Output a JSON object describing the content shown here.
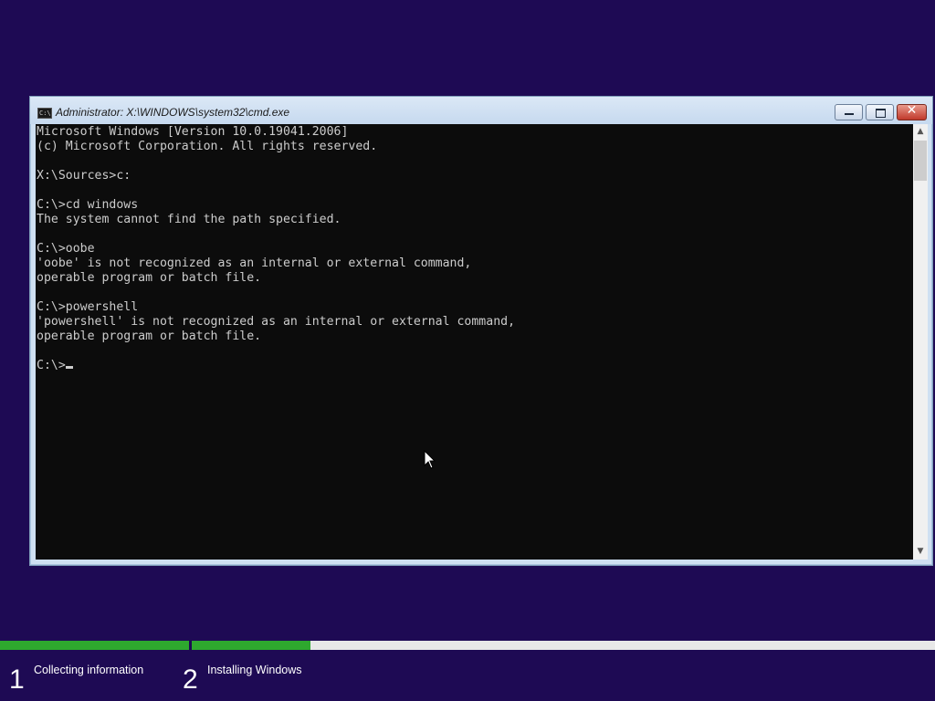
{
  "window": {
    "title": "Administrator: X:\\WINDOWS\\system32\\cmd.exe",
    "icon_name": "cmd-icon",
    "icon_text": "C:\\",
    "controls": [
      "minimize",
      "maximize",
      "close"
    ],
    "close_glyph": "✕"
  },
  "console": {
    "text": "Microsoft Windows [Version 10.0.19041.2006]\n(c) Microsoft Corporation. All rights reserved.\n\nX:\\Sources>c:\n\nC:\\>cd windows\nThe system cannot find the path specified.\n\nC:\\>oobe\n'oobe' is not recognized as an internal or external command,\noperable program or batch file.\n\nC:\\>powershell\n'powershell' is not recognized as an internal or external command,\noperable program or batch file.\n\n",
    "prompt": "C:\\>",
    "background": "#0c0c0c",
    "foreground": "#cccccc"
  },
  "scrollbar": {
    "up_arrow": "▲",
    "down_arrow": "▼"
  },
  "setup_progress": {
    "steps": [
      {
        "number": "1",
        "label": "Collecting information",
        "complete": 1.0
      },
      {
        "number": "2",
        "label": "Installing Windows",
        "complete": 0.16
      }
    ],
    "bar_color": "#2ea82e",
    "background_color": "#1e0a54"
  }
}
